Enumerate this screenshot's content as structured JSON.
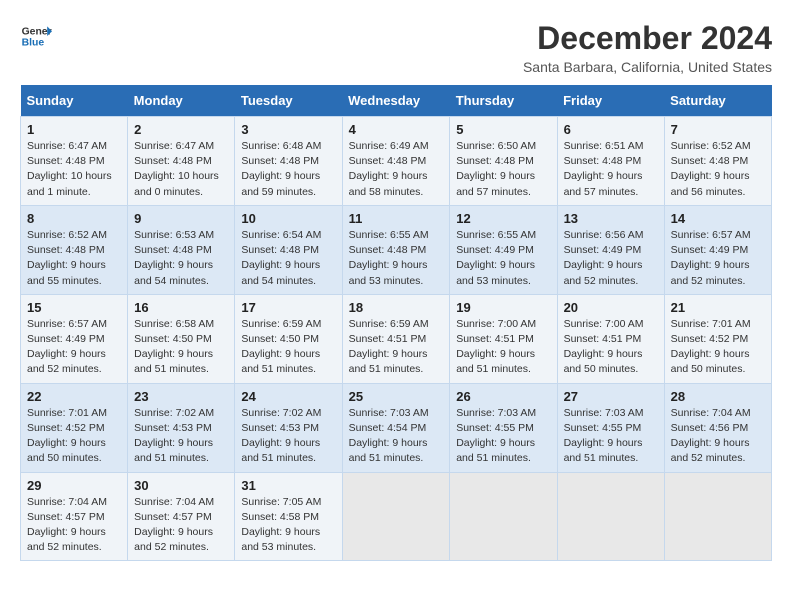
{
  "logo": {
    "line1": "General",
    "line2": "Blue"
  },
  "title": "December 2024",
  "location": "Santa Barbara, California, United States",
  "days_header": [
    "Sunday",
    "Monday",
    "Tuesday",
    "Wednesday",
    "Thursday",
    "Friday",
    "Saturday"
  ],
  "weeks": [
    [
      {
        "day": "1",
        "sunrise": "6:47 AM",
        "sunset": "4:48 PM",
        "daylight": "10 hours and 1 minute."
      },
      {
        "day": "2",
        "sunrise": "6:47 AM",
        "sunset": "4:48 PM",
        "daylight": "10 hours and 0 minutes."
      },
      {
        "day": "3",
        "sunrise": "6:48 AM",
        "sunset": "4:48 PM",
        "daylight": "9 hours and 59 minutes."
      },
      {
        "day": "4",
        "sunrise": "6:49 AM",
        "sunset": "4:48 PM",
        "daylight": "9 hours and 58 minutes."
      },
      {
        "day": "5",
        "sunrise": "6:50 AM",
        "sunset": "4:48 PM",
        "daylight": "9 hours and 57 minutes."
      },
      {
        "day": "6",
        "sunrise": "6:51 AM",
        "sunset": "4:48 PM",
        "daylight": "9 hours and 57 minutes."
      },
      {
        "day": "7",
        "sunrise": "6:52 AM",
        "sunset": "4:48 PM",
        "daylight": "9 hours and 56 minutes."
      }
    ],
    [
      {
        "day": "8",
        "sunrise": "6:52 AM",
        "sunset": "4:48 PM",
        "daylight": "9 hours and 55 minutes."
      },
      {
        "day": "9",
        "sunrise": "6:53 AM",
        "sunset": "4:48 PM",
        "daylight": "9 hours and 54 minutes."
      },
      {
        "day": "10",
        "sunrise": "6:54 AM",
        "sunset": "4:48 PM",
        "daylight": "9 hours and 54 minutes."
      },
      {
        "day": "11",
        "sunrise": "6:55 AM",
        "sunset": "4:48 PM",
        "daylight": "9 hours and 53 minutes."
      },
      {
        "day": "12",
        "sunrise": "6:55 AM",
        "sunset": "4:49 PM",
        "daylight": "9 hours and 53 minutes."
      },
      {
        "day": "13",
        "sunrise": "6:56 AM",
        "sunset": "4:49 PM",
        "daylight": "9 hours and 52 minutes."
      },
      {
        "day": "14",
        "sunrise": "6:57 AM",
        "sunset": "4:49 PM",
        "daylight": "9 hours and 52 minutes."
      }
    ],
    [
      {
        "day": "15",
        "sunrise": "6:57 AM",
        "sunset": "4:49 PM",
        "daylight": "9 hours and 52 minutes."
      },
      {
        "day": "16",
        "sunrise": "6:58 AM",
        "sunset": "4:50 PM",
        "daylight": "9 hours and 51 minutes."
      },
      {
        "day": "17",
        "sunrise": "6:59 AM",
        "sunset": "4:50 PM",
        "daylight": "9 hours and 51 minutes."
      },
      {
        "day": "18",
        "sunrise": "6:59 AM",
        "sunset": "4:51 PM",
        "daylight": "9 hours and 51 minutes."
      },
      {
        "day": "19",
        "sunrise": "7:00 AM",
        "sunset": "4:51 PM",
        "daylight": "9 hours and 51 minutes."
      },
      {
        "day": "20",
        "sunrise": "7:00 AM",
        "sunset": "4:51 PM",
        "daylight": "9 hours and 50 minutes."
      },
      {
        "day": "21",
        "sunrise": "7:01 AM",
        "sunset": "4:52 PM",
        "daylight": "9 hours and 50 minutes."
      }
    ],
    [
      {
        "day": "22",
        "sunrise": "7:01 AM",
        "sunset": "4:52 PM",
        "daylight": "9 hours and 50 minutes."
      },
      {
        "day": "23",
        "sunrise": "7:02 AM",
        "sunset": "4:53 PM",
        "daylight": "9 hours and 51 minutes."
      },
      {
        "day": "24",
        "sunrise": "7:02 AM",
        "sunset": "4:53 PM",
        "daylight": "9 hours and 51 minutes."
      },
      {
        "day": "25",
        "sunrise": "7:03 AM",
        "sunset": "4:54 PM",
        "daylight": "9 hours and 51 minutes."
      },
      {
        "day": "26",
        "sunrise": "7:03 AM",
        "sunset": "4:55 PM",
        "daylight": "9 hours and 51 minutes."
      },
      {
        "day": "27",
        "sunrise": "7:03 AM",
        "sunset": "4:55 PM",
        "daylight": "9 hours and 51 minutes."
      },
      {
        "day": "28",
        "sunrise": "7:04 AM",
        "sunset": "4:56 PM",
        "daylight": "9 hours and 52 minutes."
      }
    ],
    [
      {
        "day": "29",
        "sunrise": "7:04 AM",
        "sunset": "4:57 PM",
        "daylight": "9 hours and 52 minutes."
      },
      {
        "day": "30",
        "sunrise": "7:04 AM",
        "sunset": "4:57 PM",
        "daylight": "9 hours and 52 minutes."
      },
      {
        "day": "31",
        "sunrise": "7:05 AM",
        "sunset": "4:58 PM",
        "daylight": "9 hours and 53 minutes."
      },
      null,
      null,
      null,
      null
    ]
  ],
  "labels": {
    "sunrise": "Sunrise:",
    "sunset": "Sunset:",
    "daylight": "Daylight:"
  }
}
